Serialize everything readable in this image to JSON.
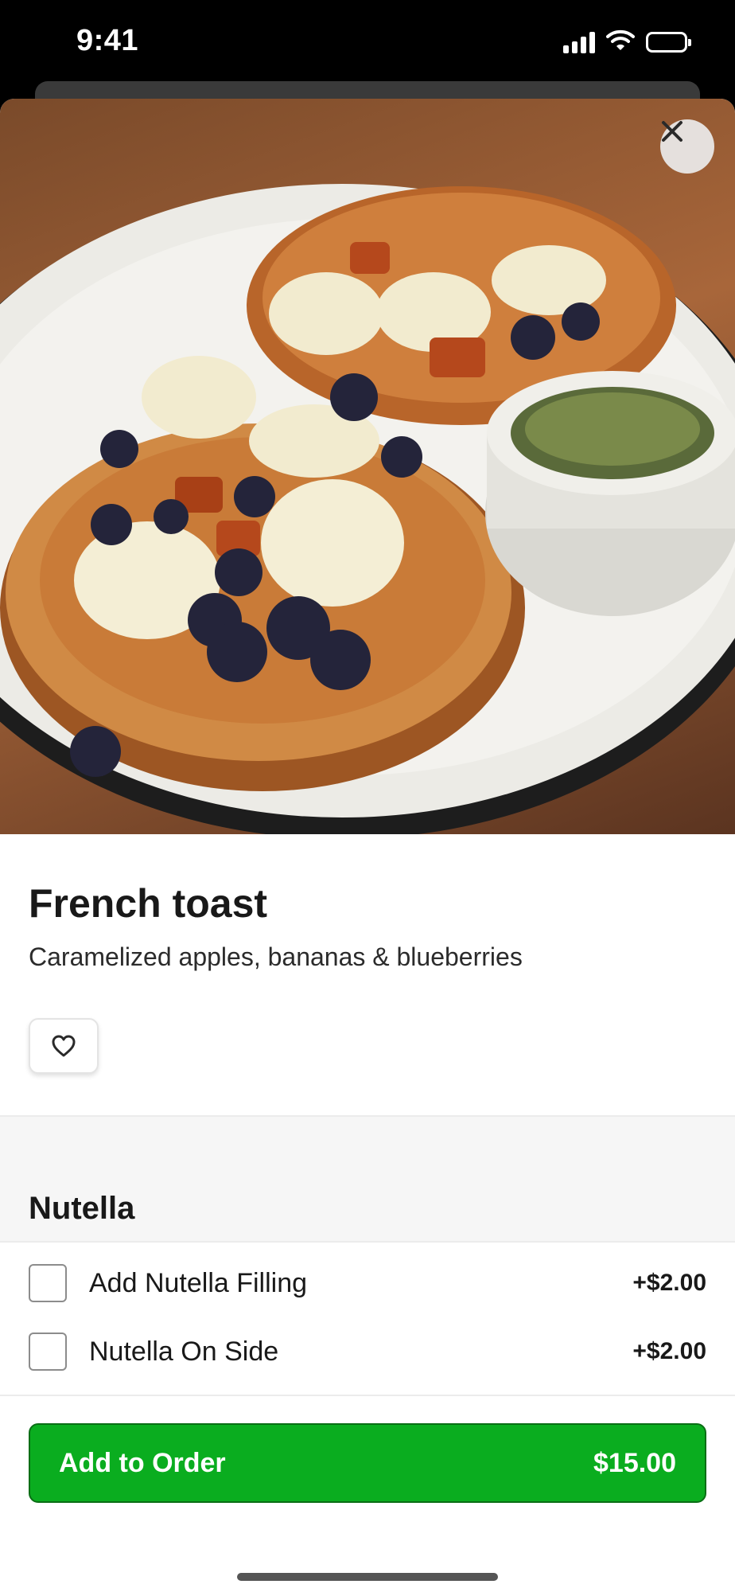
{
  "status_bar": {
    "time": "9:41"
  },
  "item": {
    "title": "French toast",
    "description": "Caramelized apples, bananas & blueberries"
  },
  "modifier_group": {
    "title": "Nutella",
    "options": [
      {
        "label": "Add Nutella Filling",
        "price": "+$2.00"
      },
      {
        "label": "Nutella On Side",
        "price": "+$2.00"
      }
    ]
  },
  "footer": {
    "add_label": "Add to Order",
    "total": "$15.00"
  },
  "colors": {
    "accent": "#0aad1f",
    "accent_border": "#0a6e15"
  },
  "icons": [
    "signal-icon",
    "wifi-icon",
    "battery-icon",
    "close-icon",
    "heart-icon"
  ]
}
